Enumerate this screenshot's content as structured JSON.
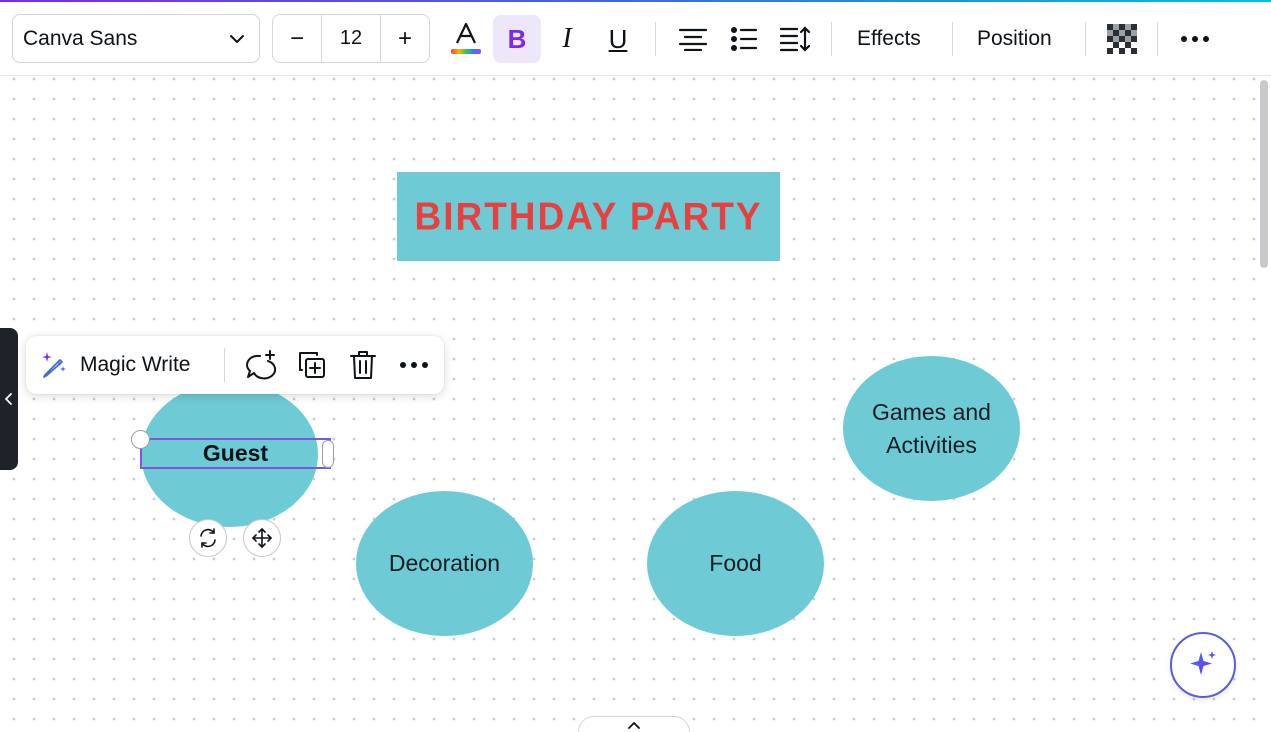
{
  "toolbar": {
    "font_family": "Canva Sans",
    "font_size": "12",
    "decrease_label": "−",
    "increase_label": "+",
    "bold_label": "B",
    "italic_label": "I",
    "underline_label": "U",
    "effects_label": "Effects",
    "position_label": "Position",
    "text_color_indicator": "rainbow",
    "bold_active": true
  },
  "canvas": {
    "banner_title": "BIRTHDAY PARTY",
    "nodes": {
      "guest": "Guest",
      "decoration": "Decoration",
      "food": "Food",
      "games_line1": "Games and",
      "games_line2": "Activities"
    }
  },
  "context_toolbar": {
    "magic_write_label": "Magic Write"
  },
  "colors": {
    "accent": "#7d2ae8",
    "shape_fill": "#6ecbd6",
    "title_red": "#e8403e",
    "selection": "#7c57d9"
  },
  "icons": [
    "chevron-down-icon",
    "text-color-icon",
    "align-center-icon",
    "bullet-list-icon",
    "line-spacing-icon",
    "transparency-icon",
    "more-icon",
    "magic-write-icon",
    "comment-add-icon",
    "duplicate-icon",
    "trash-icon",
    "rotate-icon",
    "move-icon",
    "chevron-left-icon",
    "sparkle-icon",
    "chevron-up-icon"
  ]
}
